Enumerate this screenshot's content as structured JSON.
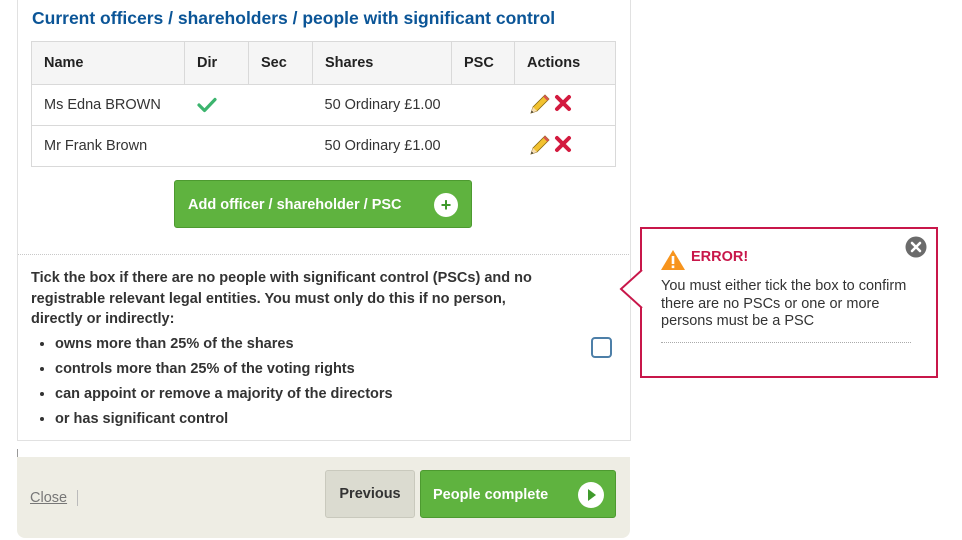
{
  "title": "Current officers / shareholders / people with significant control",
  "table": {
    "headers": [
      "Name",
      "Dir",
      "Sec",
      "Shares",
      "PSC",
      "Actions"
    ],
    "rows": [
      {
        "name": "Ms Edna BROWN",
        "dir": "check-icon",
        "shares": "50 Ordinary £1.00"
      },
      {
        "name": "Mr Frank Brown",
        "dir": "",
        "shares": "50 Ordinary £1.00"
      }
    ]
  },
  "add_button": {
    "label": "Add officer / shareholder / PSC",
    "icon": "plus-icon"
  },
  "psc": {
    "intro": "Tick the box if there are no people with significant control (PSCs) and no registrable relevant legal entities. You must only do this if no person, directly or indirectly:",
    "bullets": [
      "owns more than 25% of the shares",
      "controls more than 25% of the voting rights",
      "can appoint or remove a majority of the directors",
      "or has significant control"
    ],
    "checked": false
  },
  "error": {
    "title": "ERROR!",
    "message": "You must either tick the box to confirm there are no PSCs or one or more persons must be a PSC",
    "color": "#c8174a"
  },
  "footer": {
    "close_label": "Close",
    "previous_label": "Previous",
    "next_label": "People complete"
  },
  "colors": {
    "accent_green": "#5fb33f",
    "title_blue": "#0b5597",
    "error_red": "#c8174a"
  }
}
